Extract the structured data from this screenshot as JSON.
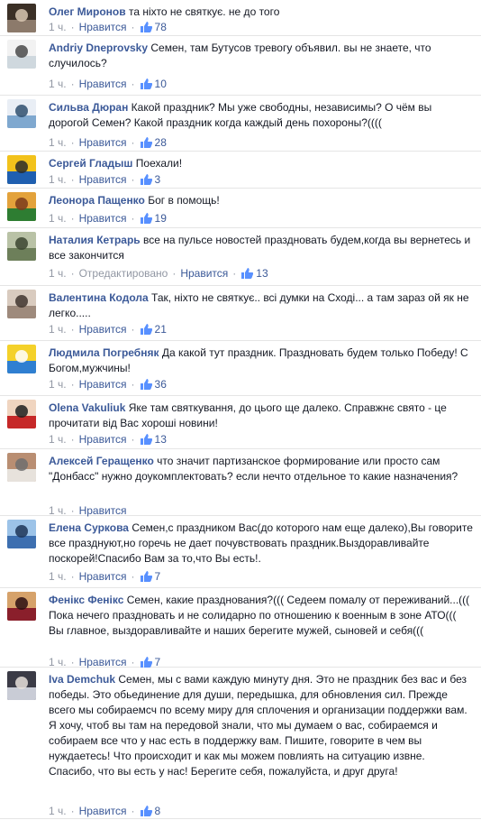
{
  "comments": [
    {
      "author": "Олег Миронов",
      "text": "та ніхто не святкує. не до того",
      "time": "1 ч.",
      "like_label": "Нравится",
      "likes": "78",
      "edited": "",
      "colors": [
        "#8c7a6b",
        "#3b3026",
        "#d8c7b2"
      ]
    },
    {
      "author": "Andriy Dneprovsky",
      "text": "Семен, там Бутусов тревогу объявил. вы не знаете, что случилось?",
      "time": "1 ч.",
      "like_label": "Нравится",
      "likes": "10",
      "edited": "",
      "colors": [
        "#cfd8de",
        "#f2f2f2",
        "#4a4a4a"
      ]
    },
    {
      "author": "Сильва Дюран",
      "text": "Какой праздник? Мы уже свободны, независимы? О чём вы дорогой Семен? Какой праздник когда каждый день похороны?((((",
      "time": "1 ч.",
      "like_label": "Нравится",
      "likes": "28",
      "edited": "",
      "colors": [
        "#7fa8cf",
        "#e9eef5",
        "#2f4f6f"
      ]
    },
    {
      "author": "Сергей Гладыш",
      "text": "Поехали!",
      "time": "1 ч.",
      "like_label": "Нравится",
      "likes": "3",
      "edited": "",
      "colors": [
        "#1f5fb0",
        "#f2c21b",
        "#2a2a2a"
      ]
    },
    {
      "author": "Леонора Пащенко",
      "text": "Бог в помощь!",
      "time": "1 ч.",
      "like_label": "Нравится",
      "likes": "19",
      "edited": "",
      "colors": [
        "#2e7d32",
        "#e3a23b",
        "#7b3b1c"
      ]
    },
    {
      "author": "Наталия Кетрарь",
      "text": "все на пульсе новостей праздновать будем,когда вы вернетесь и все закончится",
      "time": "1 ч.",
      "like_label": "Нравится",
      "likes": "13",
      "edited": "Отредактировано",
      "colors": [
        "#6d7f5a",
        "#b9c2a6",
        "#3b4530"
      ]
    },
    {
      "author": "Валентина Кодола",
      "text": "Так, ніхто не святкує.. всі думки на Сході... а там зараз ой як не легко.....",
      "time": "1 ч.",
      "like_label": "Нравится",
      "likes": "21",
      "edited": "",
      "colors": [
        "#9e8a7c",
        "#d9cbbf",
        "#3f352e"
      ]
    },
    {
      "author": "Людмила Погребняк",
      "text": "Да какой тут праздник. Праздновать будем только Победу! С Богом,мужчины!",
      "time": "1 ч.",
      "like_label": "Нравится",
      "likes": "36",
      "edited": "",
      "colors": [
        "#2f7fd1",
        "#f4d12a",
        "#ffffff"
      ]
    },
    {
      "author": "Olena Vakuliuk",
      "text": "Яке там святкування, до цього ще далеко. Справжнє свято - це прочитати від Вас хороші новини!",
      "time": "1 ч.",
      "like_label": "Нравится",
      "likes": "13",
      "edited": "",
      "colors": [
        "#c62828",
        "#f0d5c0",
        "#1e1e1e"
      ]
    },
    {
      "author": "Алексей Геращенко",
      "text": "что значит партизанское формирование или просто сам \"Донбасс\" нужно доукомплектовать? если нечто отдельное то какие назначения?",
      "time": "1 ч.",
      "like_label": "Нравится",
      "likes": "",
      "edited": "",
      "colors": [
        "#e7e2dc",
        "#b98e72",
        "#6f6f6f"
      ]
    },
    {
      "author": "Елена Суркова",
      "text": "Семен,с праздником Вас(до которого нам еще далеко),Вы говорите все празднуют,но горечь не дает почувствовать праздник.Выздоравливайте поскорей!Спасибо Вам за то,что Вы есть!.",
      "time": "1 ч.",
      "like_label": "Нравится",
      "likes": "7",
      "edited": "",
      "colors": [
        "#3d6fb0",
        "#9cc3e8",
        "#1d3557"
      ]
    },
    {
      "author": "Фенікс Фенікс",
      "text": "Семен, какие празднования?((( Седеем помалу от переживаний...((( Пока нечего праздновать и не солидарно по отношению к военным в зоне АТО((( Вы главное, выздоравливайте и наших берегите мужей, сыновей и себя(((",
      "time": "1 ч.",
      "like_label": "Нравится",
      "likes": "7",
      "edited": "",
      "colors": [
        "#8a1f2b",
        "#d6a26a",
        "#2b0f12"
      ]
    },
    {
      "author": "Iva Demchuk",
      "text": "Семен, мы с вами каждую минуту дня. Это не праздник без вас и без победы. Это обьединение для души, передышка, для обновления сил. Прежде всего мы собираемсч по всему миру для сплочения и организации поддержки вам. Я хочу, чтоб вы там на передовой знали, что мы думаем о вас, собираемся и собираем все что у нас есть в поддержку вам. Пишите, говорите в чем вы нуждаетесь! Что происходит и как мы можем повлиять на ситуацию извне. Спасибо, что вы есть у нас! Берегите себя, пожалуйста, и друг друга!",
      "time": "1 ч.",
      "like_label": "Нравится",
      "likes": "8",
      "edited": "",
      "colors": [
        "#c9ccd6",
        "#3b3b46",
        "#e8e1da"
      ]
    }
  ]
}
